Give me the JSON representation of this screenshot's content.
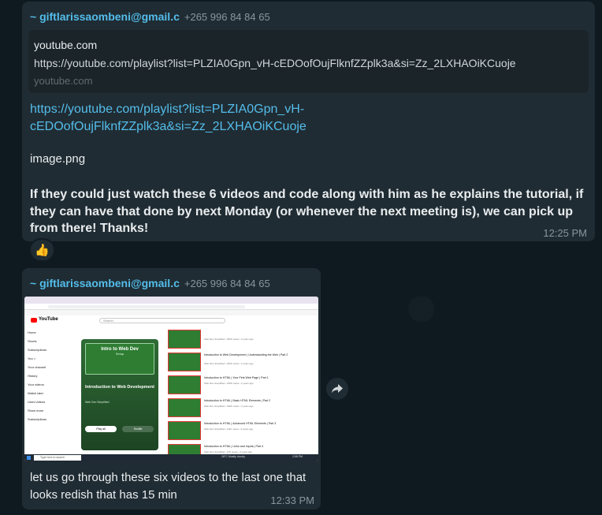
{
  "message1": {
    "sender": "~ giftlarissaombeni@gmail.c",
    "phone": "+265 996 84 84 65",
    "preview": {
      "site": "youtube.com",
      "url": "https://youtube.com/playlist?list=PLZIA0Gpn_vH-cEDOofOujFlknfZZplk3a&si=Zz_2LXHAOiKCuoje",
      "site_footer": "youtube.com"
    },
    "link_line1": "https://youtube.com/playlist?list=PLZIA0Gpn_vH-",
    "link_line2": "cEDOofOujFlknfZZplk3a&si=Zz_2LXHAOiKCuoje",
    "filename": "image.png",
    "text": "If they could just watch these 6 videos and code along with him as he explains the tutorial, if they can have that done by next Monday (or whenever the next meeting is), we can pick up from there!  Thanks!",
    "time": "12:25 PM",
    "reaction": "👍"
  },
  "message2": {
    "sender": "~ giftlarissaombeni@gmail.c",
    "phone": "+265 996 84 84 65",
    "text": "let us go through these six videos to the last one that looks redish that has 15 min",
    "time": "12:33 PM"
  },
  "screenshot": {
    "search_placeholder": "Search",
    "youtube_label": "YouTube",
    "sidebar": [
      "Home",
      "Shorts",
      "Subscriptions",
      "You >",
      "Your channel",
      "History",
      "Your videos",
      "Watch later",
      "Liked videos",
      "Show more",
      "Subscriptions"
    ],
    "playlist_banner_top": "Intro to Web Dev",
    "playlist_banner_sub": "Setup",
    "playlist_title": "Introduction to Web Development",
    "playlist_author": "Web Dev Simplified",
    "play_all": "Play all",
    "shuffle": "Shuffle",
    "videos": [
      {
        "title": "",
        "meta": "Web Dev Simplified • 469K views • 3 years ago"
      },
      {
        "title": "Introduction to Web Development | Understanding the Web | Part 2",
        "meta": "Web Dev Simplified • 266K views • 3 years ago"
      },
      {
        "title": "Introduction to HTML | Your First Web Page | Part 1",
        "meta": "Web Dev Simplified • 318K views • 3 years ago"
      },
      {
        "title": "Introduction to HTML | Basic HTML Elements | Part 2",
        "meta": "Web Dev Simplified • 190K views • 3 years ago"
      },
      {
        "title": "Introduction to HTML | Advanced HTML Elements | Part 3",
        "meta": "Web Dev Simplified • 111K views • 3 years ago"
      },
      {
        "title": "Introduction to HTML | Links and Inputs | Part 4",
        "meta": "Web Dev Simplified • 97K views • 3 years ago"
      }
    ],
    "taskbar_search": "Type here to search",
    "taskbar_weather": "26°C  Mostly cloudy",
    "taskbar_time": "2:58 PM"
  },
  "colors": {
    "bubble": "#202c33",
    "sender": "#53bdeb",
    "link": "#53bdeb",
    "text": "#e9edef",
    "meta": "#8696a0"
  }
}
